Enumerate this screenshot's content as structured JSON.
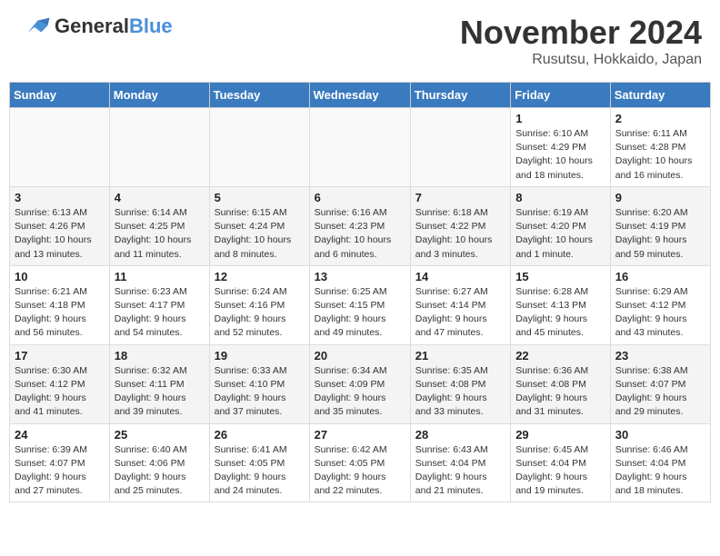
{
  "header": {
    "logo_line1": "General",
    "logo_line2": "Blue",
    "month_title": "November 2024",
    "location": "Rusutsu, Hokkaido, Japan"
  },
  "weekdays": [
    "Sunday",
    "Monday",
    "Tuesday",
    "Wednesday",
    "Thursday",
    "Friday",
    "Saturday"
  ],
  "weeks": [
    [
      {
        "day": "",
        "info": ""
      },
      {
        "day": "",
        "info": ""
      },
      {
        "day": "",
        "info": ""
      },
      {
        "day": "",
        "info": ""
      },
      {
        "day": "",
        "info": ""
      },
      {
        "day": "1",
        "info": "Sunrise: 6:10 AM\nSunset: 4:29 PM\nDaylight: 10 hours\nand 18 minutes."
      },
      {
        "day": "2",
        "info": "Sunrise: 6:11 AM\nSunset: 4:28 PM\nDaylight: 10 hours\nand 16 minutes."
      }
    ],
    [
      {
        "day": "3",
        "info": "Sunrise: 6:13 AM\nSunset: 4:26 PM\nDaylight: 10 hours\nand 13 minutes."
      },
      {
        "day": "4",
        "info": "Sunrise: 6:14 AM\nSunset: 4:25 PM\nDaylight: 10 hours\nand 11 minutes."
      },
      {
        "day": "5",
        "info": "Sunrise: 6:15 AM\nSunset: 4:24 PM\nDaylight: 10 hours\nand 8 minutes."
      },
      {
        "day": "6",
        "info": "Sunrise: 6:16 AM\nSunset: 4:23 PM\nDaylight: 10 hours\nand 6 minutes."
      },
      {
        "day": "7",
        "info": "Sunrise: 6:18 AM\nSunset: 4:22 PM\nDaylight: 10 hours\nand 3 minutes."
      },
      {
        "day": "8",
        "info": "Sunrise: 6:19 AM\nSunset: 4:20 PM\nDaylight: 10 hours\nand 1 minute."
      },
      {
        "day": "9",
        "info": "Sunrise: 6:20 AM\nSunset: 4:19 PM\nDaylight: 9 hours\nand 59 minutes."
      }
    ],
    [
      {
        "day": "10",
        "info": "Sunrise: 6:21 AM\nSunset: 4:18 PM\nDaylight: 9 hours\nand 56 minutes."
      },
      {
        "day": "11",
        "info": "Sunrise: 6:23 AM\nSunset: 4:17 PM\nDaylight: 9 hours\nand 54 minutes."
      },
      {
        "day": "12",
        "info": "Sunrise: 6:24 AM\nSunset: 4:16 PM\nDaylight: 9 hours\nand 52 minutes."
      },
      {
        "day": "13",
        "info": "Sunrise: 6:25 AM\nSunset: 4:15 PM\nDaylight: 9 hours\nand 49 minutes."
      },
      {
        "day": "14",
        "info": "Sunrise: 6:27 AM\nSunset: 4:14 PM\nDaylight: 9 hours\nand 47 minutes."
      },
      {
        "day": "15",
        "info": "Sunrise: 6:28 AM\nSunset: 4:13 PM\nDaylight: 9 hours\nand 45 minutes."
      },
      {
        "day": "16",
        "info": "Sunrise: 6:29 AM\nSunset: 4:12 PM\nDaylight: 9 hours\nand 43 minutes."
      }
    ],
    [
      {
        "day": "17",
        "info": "Sunrise: 6:30 AM\nSunset: 4:12 PM\nDaylight: 9 hours\nand 41 minutes."
      },
      {
        "day": "18",
        "info": "Sunrise: 6:32 AM\nSunset: 4:11 PM\nDaylight: 9 hours\nand 39 minutes."
      },
      {
        "day": "19",
        "info": "Sunrise: 6:33 AM\nSunset: 4:10 PM\nDaylight: 9 hours\nand 37 minutes."
      },
      {
        "day": "20",
        "info": "Sunrise: 6:34 AM\nSunset: 4:09 PM\nDaylight: 9 hours\nand 35 minutes."
      },
      {
        "day": "21",
        "info": "Sunrise: 6:35 AM\nSunset: 4:08 PM\nDaylight: 9 hours\nand 33 minutes."
      },
      {
        "day": "22",
        "info": "Sunrise: 6:36 AM\nSunset: 4:08 PM\nDaylight: 9 hours\nand 31 minutes."
      },
      {
        "day": "23",
        "info": "Sunrise: 6:38 AM\nSunset: 4:07 PM\nDaylight: 9 hours\nand 29 minutes."
      }
    ],
    [
      {
        "day": "24",
        "info": "Sunrise: 6:39 AM\nSunset: 4:07 PM\nDaylight: 9 hours\nand 27 minutes."
      },
      {
        "day": "25",
        "info": "Sunrise: 6:40 AM\nSunset: 4:06 PM\nDaylight: 9 hours\nand 25 minutes."
      },
      {
        "day": "26",
        "info": "Sunrise: 6:41 AM\nSunset: 4:05 PM\nDaylight: 9 hours\nand 24 minutes."
      },
      {
        "day": "27",
        "info": "Sunrise: 6:42 AM\nSunset: 4:05 PM\nDaylight: 9 hours\nand 22 minutes."
      },
      {
        "day": "28",
        "info": "Sunrise: 6:43 AM\nSunset: 4:04 PM\nDaylight: 9 hours\nand 21 minutes."
      },
      {
        "day": "29",
        "info": "Sunrise: 6:45 AM\nSunset: 4:04 PM\nDaylight: 9 hours\nand 19 minutes."
      },
      {
        "day": "30",
        "info": "Sunrise: 6:46 AM\nSunset: 4:04 PM\nDaylight: 9 hours\nand 18 minutes."
      }
    ]
  ]
}
